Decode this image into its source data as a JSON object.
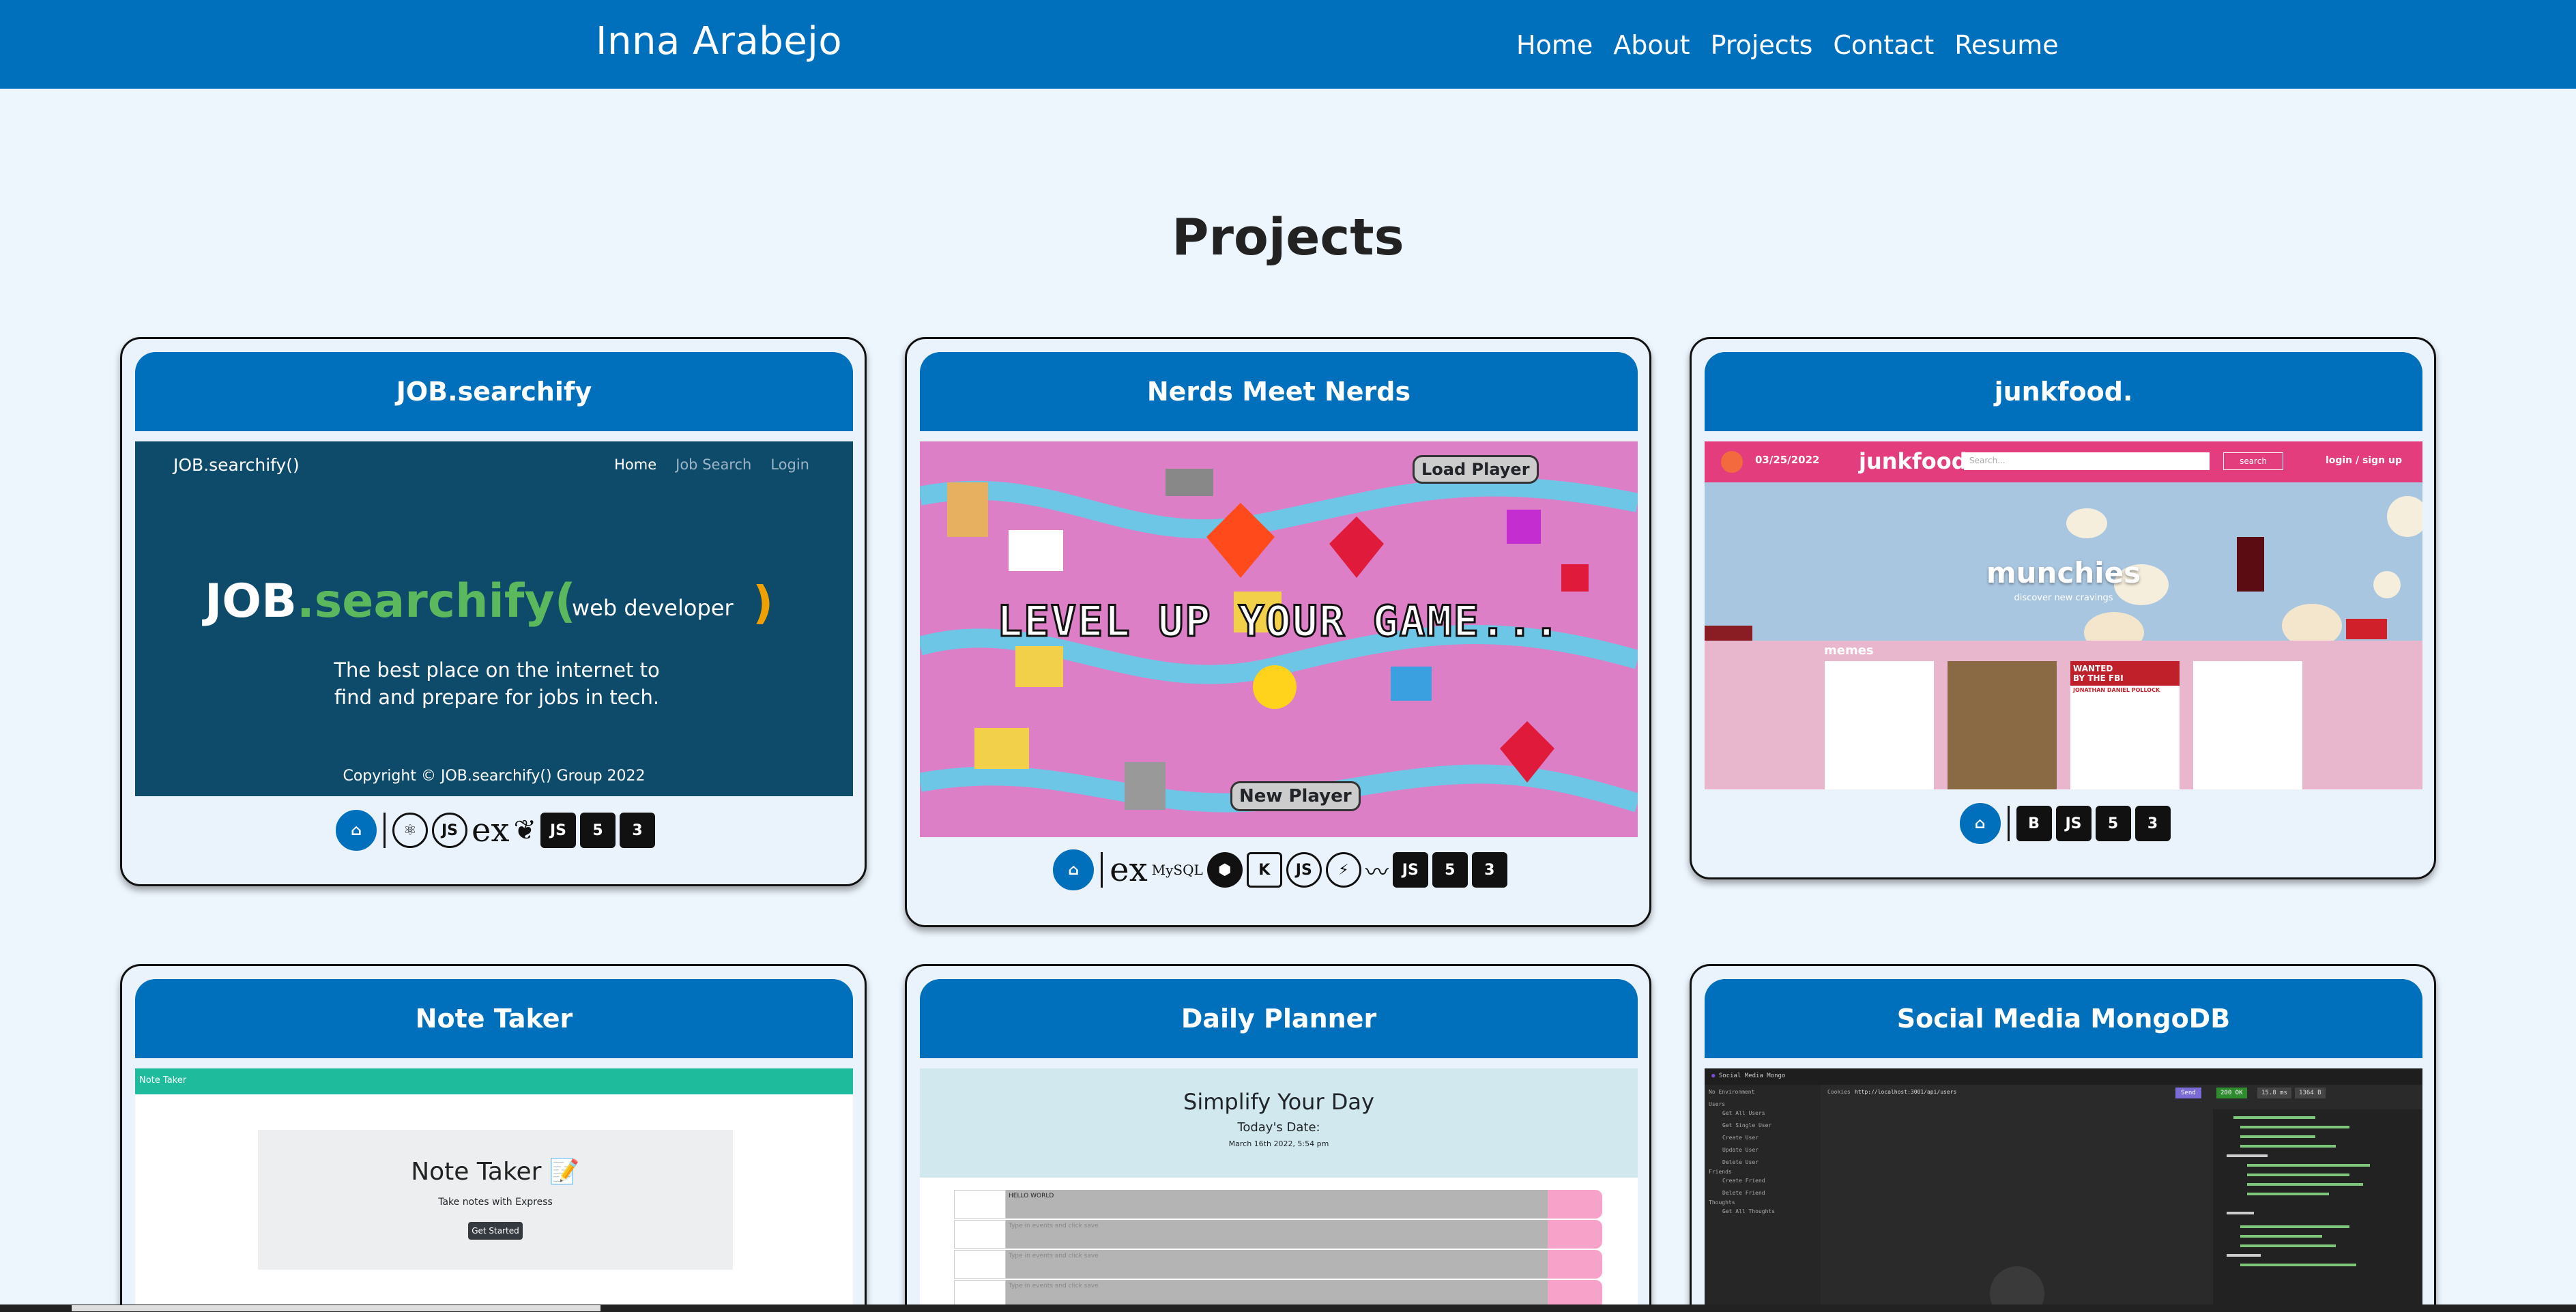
{
  "nav": {
    "brand": "Inna Arabejo",
    "links": [
      "Home",
      "About",
      "Projects",
      "Contact",
      "Resume"
    ]
  },
  "page_title": "Projects",
  "projects": [
    {
      "title": "JOB.searchify",
      "shot": {
        "brand": "JOB.searchify()",
        "nav": [
          "Home",
          "Job Search",
          "Login"
        ],
        "logo_a": "JOB",
        "logo_b": ".searchify(",
        "logo_c": ")",
        "typed": "web developer",
        "tagline": "The best place on the internet to find and prepare for jobs in tech.",
        "copyright": "Copyright © JOB.searchify() Group 2022"
      }
    },
    {
      "title": "Nerds Meet Nerds",
      "shot": {
        "headline": "LEVEL UP YOUR GAME...",
        "load_btn": "Load Player",
        "new_btn": "New Player"
      }
    },
    {
      "title": "junkfood.",
      "shot": {
        "date": "03/25/2022",
        "brand": "junkfood.",
        "search_placeholder": "Search...",
        "search_btn": "search",
        "auth": "login / sign up",
        "hero": "munchies",
        "hero_sub": "discover new cravings",
        "memes": "memes",
        "wanted_a": "WANTED",
        "wanted_b": "BY THE FBI",
        "wanted_name": "JONATHAN DANIEL POLLOCK"
      }
    },
    {
      "title": "Note Taker",
      "shot": {
        "bar": "Note Taker",
        "heading": "Note Taker 📝",
        "sub": "Take notes with Express",
        "btn": "Get Started"
      }
    },
    {
      "title": "Daily Planner",
      "shot": {
        "heading": "Simplify Your Day",
        "date_label": "Today's Date:",
        "date": "March 16th 2022, 5:54 pm",
        "first_event": "HELLO WORLD",
        "placeholder": "Type in events and click save"
      }
    },
    {
      "title": "Social Media MongoDB",
      "shot": {
        "workspace": "Social Media Mongo",
        "url": "http://localhost:3001/api/users",
        "send": "Send",
        "status": "200 OK",
        "time": "15.8 ms",
        "size": "1364 B",
        "env": "No Environment",
        "cookies": "Cookies",
        "routes": [
          "Get All Users",
          "Get Single User",
          "Create User",
          "Update User",
          "Delete User",
          "Create Friend",
          "Delete Friend",
          "Get All Thoughts"
        ],
        "groups": [
          "Users",
          "Friends",
          "Thoughts"
        ]
      }
    }
  ],
  "tech": {
    "p1": [
      "github-icon",
      "react-icon",
      "nodejs-icon",
      "express-icon",
      "mongodb-icon",
      "javascript-icon",
      "html5-icon",
      "css3-icon"
    ],
    "p2": [
      "github-icon",
      "express-icon",
      "mysql-icon",
      "sequelize-icon",
      "handlebars-icon",
      "nodejs-icon",
      "socketio-icon",
      "mustache-icon",
      "javascript-icon",
      "html5-icon",
      "css3-icon"
    ],
    "p3": [
      "github-icon",
      "bootstrap-icon",
      "javascript-icon",
      "html5-icon",
      "css3-icon"
    ]
  },
  "colors": {
    "nav": "#0070bc",
    "page_bg": "#edf5fd",
    "card_border": "#111111"
  }
}
